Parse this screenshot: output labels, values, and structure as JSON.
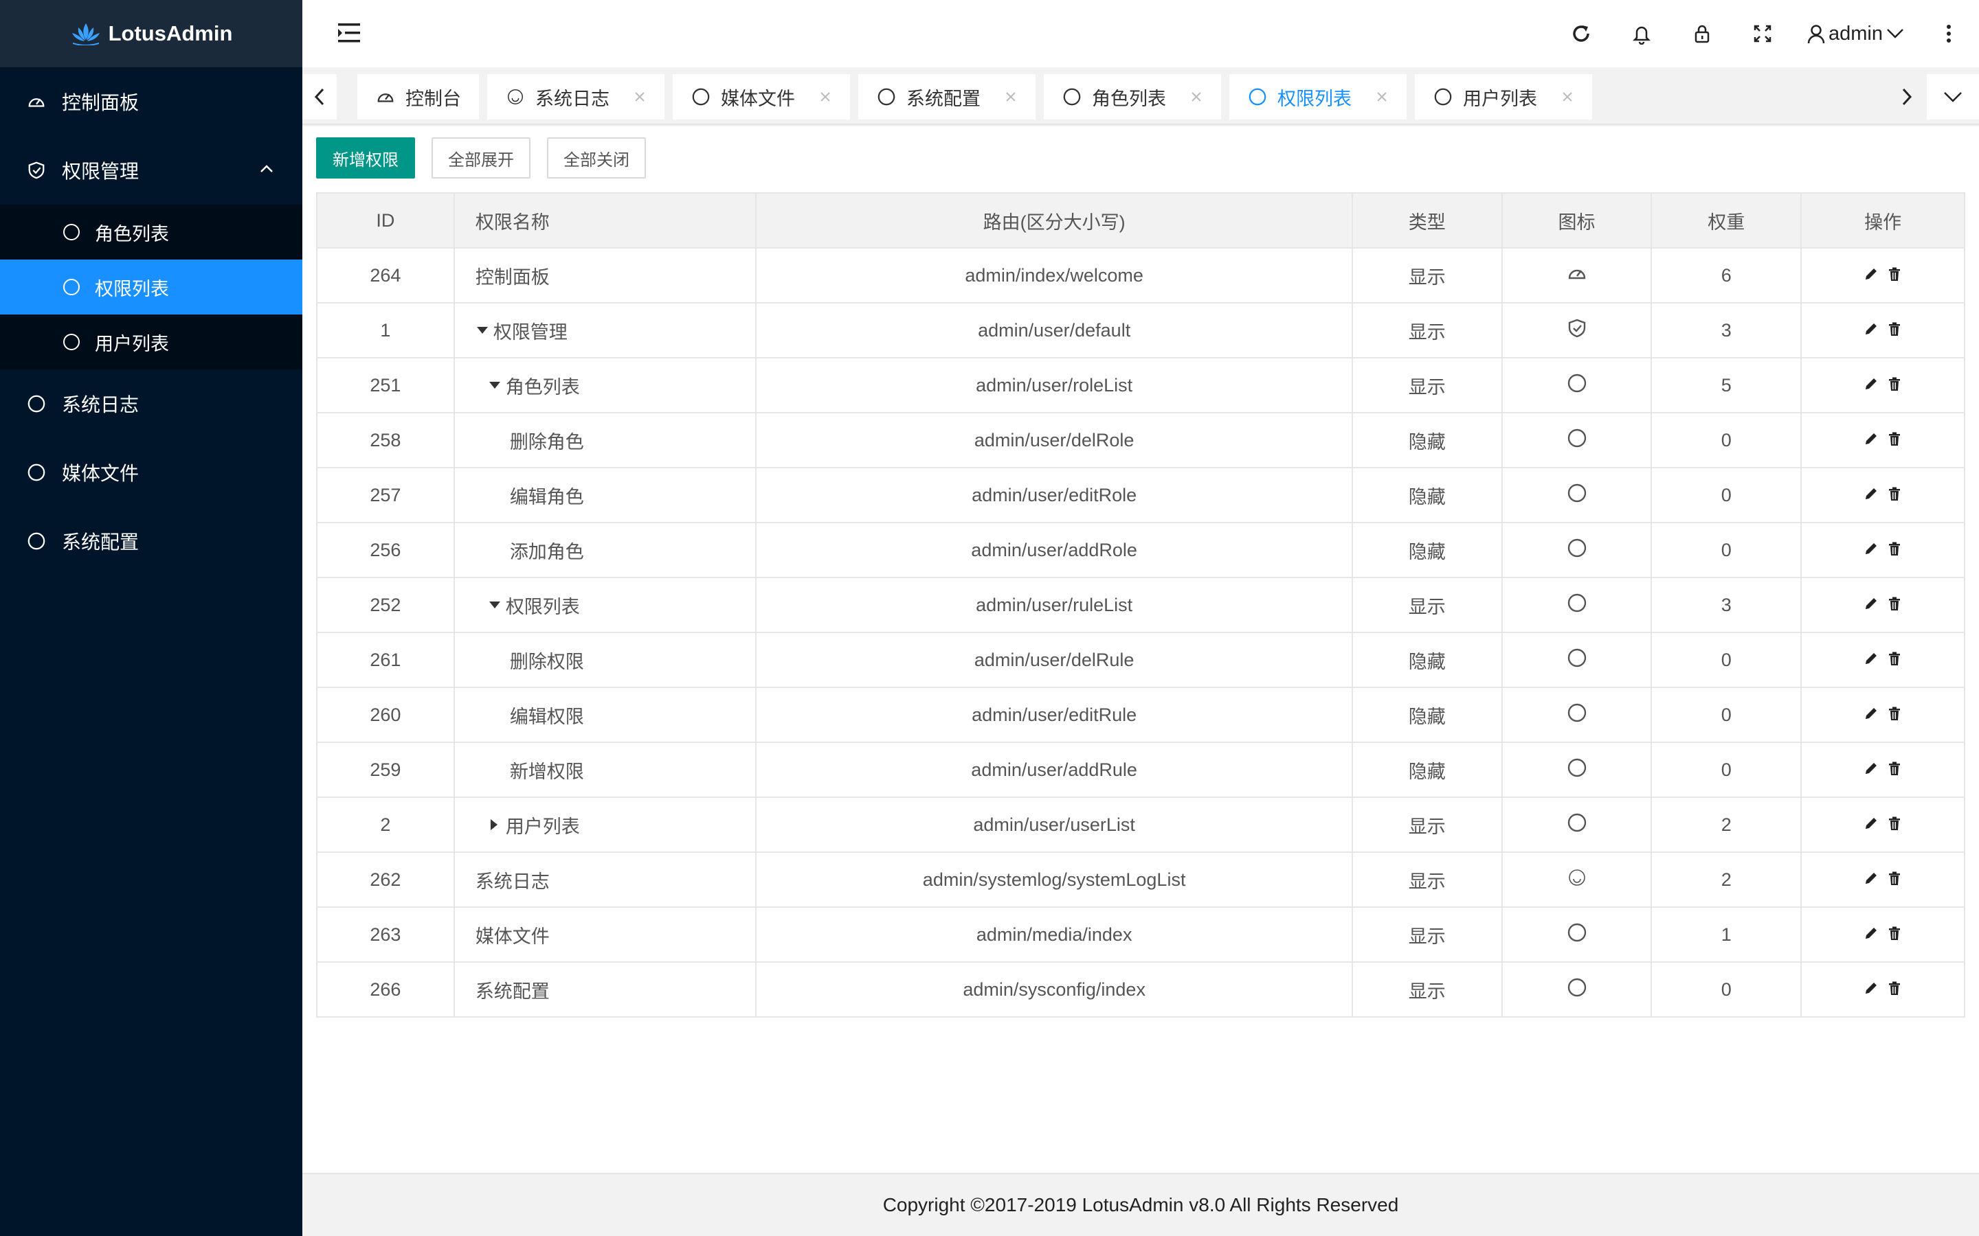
{
  "brand": {
    "name": "LotusAdmin"
  },
  "sidebar": {
    "items": [
      {
        "label": "控制面板",
        "icon": "dashboard-icon"
      },
      {
        "label": "权限管理",
        "icon": "shield-icon",
        "expanded": true,
        "children": [
          {
            "label": "角色列表",
            "active": false
          },
          {
            "label": "权限列表",
            "active": true
          },
          {
            "label": "用户列表",
            "active": false
          }
        ]
      },
      {
        "label": "系统日志",
        "icon": "circle-icon"
      },
      {
        "label": "媒体文件",
        "icon": "circle-icon"
      },
      {
        "label": "系统配置",
        "icon": "circle-icon"
      }
    ]
  },
  "header": {
    "user": "admin"
  },
  "tabs": [
    {
      "label": "控制台",
      "icon": "dashboard-icon",
      "closable": false,
      "active": false
    },
    {
      "label": "系统日志",
      "icon": "smile-icon",
      "closable": true,
      "active": false
    },
    {
      "label": "媒体文件",
      "icon": "circle-icon",
      "closable": true,
      "active": false
    },
    {
      "label": "系统配置",
      "icon": "circle-icon",
      "closable": true,
      "active": false
    },
    {
      "label": "角色列表",
      "icon": "circle-icon",
      "closable": true,
      "active": false
    },
    {
      "label": "权限列表",
      "icon": "circle-icon",
      "closable": true,
      "active": true
    },
    {
      "label": "用户列表",
      "icon": "circle-icon",
      "closable": true,
      "active": false
    }
  ],
  "toolbar": {
    "add": "新增权限",
    "expand_all": "全部展开",
    "collapse_all": "全部关闭"
  },
  "table": {
    "headers": [
      "ID",
      "权限名称",
      "路由(区分大小写)",
      "类型",
      "图标",
      "权重",
      "操作"
    ],
    "rows": [
      {
        "id": "264",
        "name": "控制面板",
        "level": 0,
        "toggle": "",
        "route": "admin/index/welcome",
        "type": "显示",
        "icon": "dashboard-icon",
        "weight": "6"
      },
      {
        "id": "1",
        "name": "权限管理",
        "level": 0,
        "toggle": "down",
        "route": "admin/user/default",
        "type": "显示",
        "icon": "shield-icon",
        "weight": "3"
      },
      {
        "id": "251",
        "name": "角色列表",
        "level": 1,
        "toggle": "down",
        "route": "admin/user/roleList",
        "type": "显示",
        "icon": "circle-icon",
        "weight": "5"
      },
      {
        "id": "258",
        "name": "删除角色",
        "level": 2,
        "toggle": "",
        "route": "admin/user/delRole",
        "type": "隐藏",
        "icon": "circle-icon",
        "weight": "0"
      },
      {
        "id": "257",
        "name": "编辑角色",
        "level": 2,
        "toggle": "",
        "route": "admin/user/editRole",
        "type": "隐藏",
        "icon": "circle-icon",
        "weight": "0"
      },
      {
        "id": "256",
        "name": "添加角色",
        "level": 2,
        "toggle": "",
        "route": "admin/user/addRole",
        "type": "隐藏",
        "icon": "circle-icon",
        "weight": "0"
      },
      {
        "id": "252",
        "name": "权限列表",
        "level": 1,
        "toggle": "down",
        "route": "admin/user/ruleList",
        "type": "显示",
        "icon": "circle-icon",
        "weight": "3"
      },
      {
        "id": "261",
        "name": "删除权限",
        "level": 2,
        "toggle": "",
        "route": "admin/user/delRule",
        "type": "隐藏",
        "icon": "circle-icon",
        "weight": "0"
      },
      {
        "id": "260",
        "name": "编辑权限",
        "level": 2,
        "toggle": "",
        "route": "admin/user/editRule",
        "type": "隐藏",
        "icon": "circle-icon",
        "weight": "0"
      },
      {
        "id": "259",
        "name": "新增权限",
        "level": 2,
        "toggle": "",
        "route": "admin/user/addRule",
        "type": "隐藏",
        "icon": "circle-icon",
        "weight": "0"
      },
      {
        "id": "2",
        "name": "用户列表",
        "level": 1,
        "toggle": "right",
        "route": "admin/user/userList",
        "type": "显示",
        "icon": "circle-icon",
        "weight": "2"
      },
      {
        "id": "262",
        "name": "系统日志",
        "level": 0,
        "toggle": "",
        "route": "admin/systemlog/systemLogList",
        "type": "显示",
        "icon": "smile-icon",
        "weight": "2"
      },
      {
        "id": "263",
        "name": "媒体文件",
        "level": 0,
        "toggle": "",
        "route": "admin/media/index",
        "type": "显示",
        "icon": "circle-icon",
        "weight": "1"
      },
      {
        "id": "266",
        "name": "系统配置",
        "level": 0,
        "toggle": "",
        "route": "admin/sysconfig/index",
        "type": "显示",
        "icon": "circle-icon",
        "weight": "0"
      }
    ]
  },
  "footer": {
    "text": "Copyright ©2017-2019 LotusAdmin v8.0 All Rights Reserved"
  },
  "colors": {
    "sidebar_bg": "#001529",
    "accent": "#1890ff",
    "primary_button": "#009688"
  }
}
